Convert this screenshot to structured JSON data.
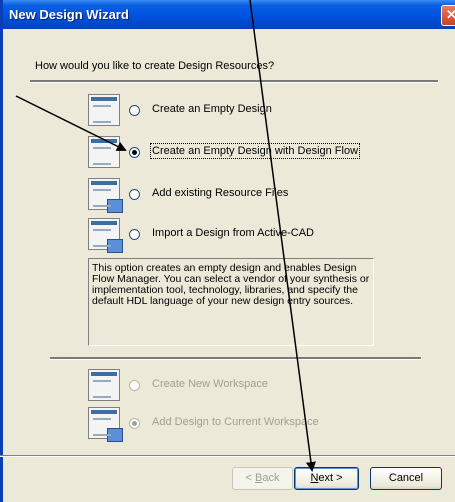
{
  "window": {
    "title": "New Design Wizard",
    "close_glyph": "✕"
  },
  "prompt": "How would you like to create Design Resources?",
  "options": [
    {
      "label": "Create an Empty Design",
      "selected": false,
      "icon": "empty-design-icon"
    },
    {
      "label": "Create an Empty Design with Design Flow",
      "selected": true,
      "icon": "design-flow-icon"
    },
    {
      "label": "Add existing Resource Files",
      "selected": false,
      "icon": "resource-files-icon"
    },
    {
      "label": "Import a Design from Active-CAD",
      "selected": false,
      "icon": "import-cad-icon"
    }
  ],
  "description_lines": [
    "This option creates an empty design and enables Design",
    "Flow Manager. You can select a vendor of your synthesis or",
    "implementation tool, technology, libraries, and specify the",
    "default HDL language of your new design entry sources."
  ],
  "workspace_options": [
    {
      "label": "Create New Workspace",
      "selected": false,
      "enabled": false,
      "icon": "workspace-icon"
    },
    {
      "label": "Add Design to Current Workspace",
      "selected": true,
      "enabled": false,
      "icon": "add-to-workspace-icon"
    }
  ],
  "buttons": {
    "back": {
      "prefix": "< ",
      "mnemonic": "B",
      "rest": "ack",
      "enabled": false
    },
    "next": {
      "mnemonic": "N",
      "rest": "ext >",
      "enabled": true
    },
    "cancel": {
      "label": "Cancel",
      "enabled": true
    }
  },
  "colors": {
    "titlebar": "#0054e3",
    "face": "#ece9d8",
    "annotation": "#000000"
  }
}
